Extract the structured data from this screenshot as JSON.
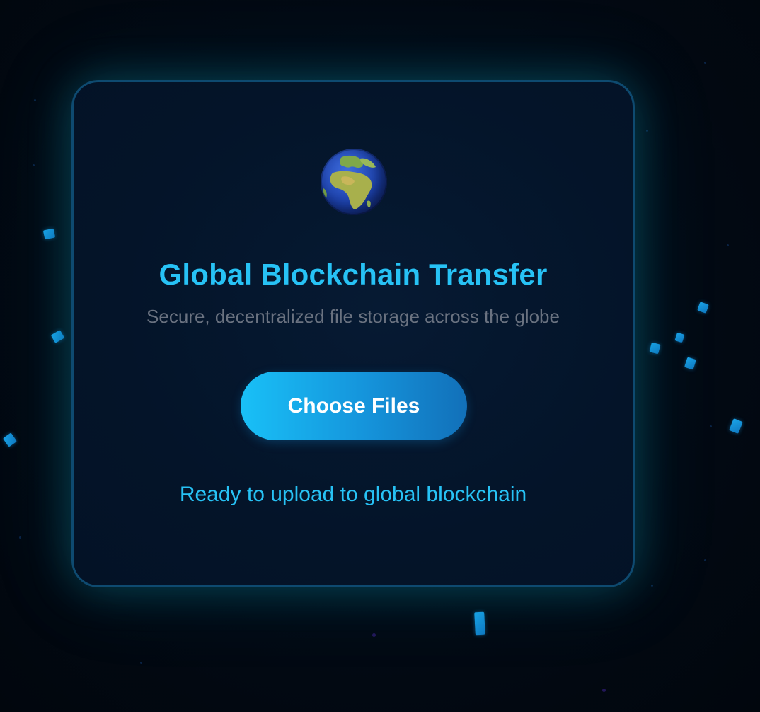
{
  "app": {
    "title": "Global Blockchain Transfer",
    "subtitle": "Secure, decentralized file storage across the globe",
    "icon": "globe-europe-africa-icon"
  },
  "upload": {
    "button_label": "Choose Files",
    "status_text": "Ready to upload to global blockchain"
  },
  "colors": {
    "accent": "#27c2f5",
    "button_gradient_start": "#19c0f7",
    "button_gradient_end": "#1270b9",
    "background": "#020a14",
    "card_border": "#0e4a70",
    "subtitle_text": "#6a7280"
  }
}
